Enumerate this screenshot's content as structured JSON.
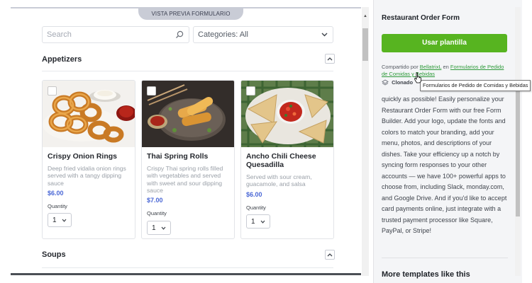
{
  "preview": {
    "tab_label": "VISTA PREVIA FORMULARIO",
    "search_placeholder": "Search",
    "category_label": "Categories:",
    "category_value": "All"
  },
  "sections": [
    {
      "title": "Appetizers",
      "items": [
        {
          "name": "Crispy Onion Rings",
          "description": "Deep fried vidalia onion rings served with a tangy dipping sauce",
          "price": "$6.00",
          "quantity_label": "Quantity",
          "quantity": "1"
        },
        {
          "name": "Thai Spring Rolls",
          "description": "Crispy Thai spring rolls filled with vegetables and served with sweet and sour dipping sauce",
          "price": "$7.00",
          "quantity_label": "Quantity",
          "quantity": "1"
        },
        {
          "name": "Ancho Chili Cheese Quesadilla",
          "description": "Served with sour cream, guacamole, and salsa",
          "price": "$6.00",
          "quantity_label": "Quantity",
          "quantity": "1"
        }
      ]
    },
    {
      "title": "Soups"
    }
  ],
  "sidebar": {
    "title": "Restaurant Order Form",
    "use_button": "Usar plantilla",
    "shared_prefix": "Compartido por",
    "shared_user": "BellatrixL",
    "shared_middle": "en",
    "shared_category": "Formularios de Pedido de Comidas y Bebidas",
    "cloned_label": "Clonado",
    "description": "quickly as possible! Easily personalize your Restaurant Order Form with our free Form Builder. Add your logo, update the fonts and colors to match your branding, add your menu, photos, and descriptions of your dishes. Take your efficiency up a notch by syncing form responses to your other accounts — we have 100+ powerful apps to choose from, including Slack, monday.com, and Google Drive. And if you'd like to accept card payments online, just integrate with a trusted payment processor like Square, PayPal, or Stripe!",
    "bottom_heading": "More templates like this"
  },
  "tooltip": "Formularios de Pedido de Comidas y Bebidas",
  "colors": {
    "accent_green": "#57b420",
    "link_green": "#2e9a3a",
    "price_blue": "#4a67d6"
  },
  "icons": [
    "search-icon",
    "chevron-down-icon",
    "chevron-up-icon",
    "layers-icon",
    "hand-cursor-icon"
  ]
}
